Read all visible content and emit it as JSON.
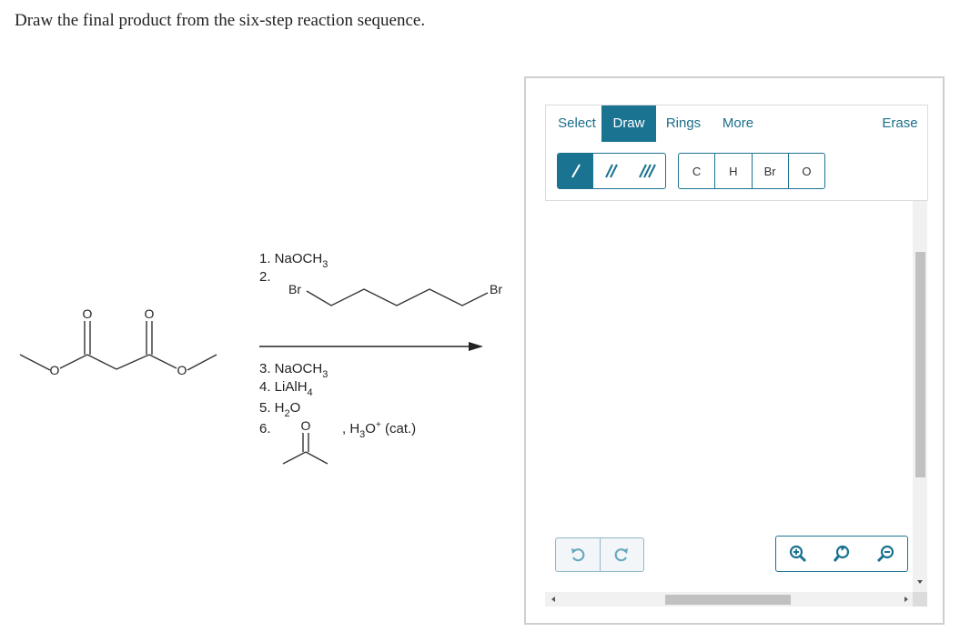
{
  "question": "Draw the final product from the six-step reaction sequence.",
  "reaction": {
    "step1": "1. NaOCH",
    "step1_sub": "3",
    "step2": "2.",
    "reagent2_left_atom": "Br",
    "reagent2_right_atom": "Br",
    "step3": "3. NaOCH",
    "step3_sub": "3",
    "step4": "4. LiAlH",
    "step4_sub": "4",
    "step5a": "5. H",
    "step5_sub": "2",
    "step5b": "O",
    "step6": "6.",
    "step6_reagent_atom": "O",
    "step6_catalyst_a": ", H",
    "step6_catalyst_sub": "3",
    "step6_catalyst_b": "O",
    "step6_catalyst_sup": "+",
    "step6_catalyst_c": " (cat.)",
    "start_material_atoms": [
      "O",
      "O",
      "O",
      "O"
    ]
  },
  "editor": {
    "tabs": [
      "Select",
      "Draw",
      "Rings",
      "More",
      "Erase"
    ],
    "active_tab": "Draw",
    "bond_tools": [
      "single-bond",
      "double-bond",
      "triple-bond"
    ],
    "active_bond": "single-bond",
    "atoms": [
      "C",
      "H",
      "Br",
      "O"
    ],
    "history_tools": [
      "undo",
      "redo"
    ],
    "zoom_tools": [
      "zoom-in",
      "reset-zoom",
      "zoom-out"
    ]
  },
  "colors": {
    "accent": "#1b7392",
    "tab_text": "#1b6f8a",
    "border": "#cfcfcf"
  }
}
